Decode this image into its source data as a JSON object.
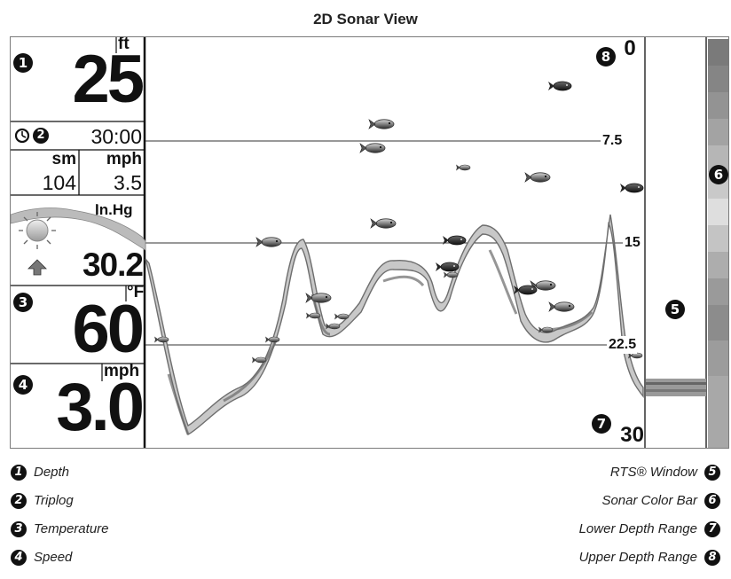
{
  "title": "2D Sonar View",
  "callouts": {
    "c1": "1",
    "c2": "2",
    "c3": "3",
    "c4": "4",
    "c5": "5",
    "c6": "6",
    "c7": "7",
    "c8": "8"
  },
  "readouts": {
    "depth_unit": "ft",
    "depth_value": "25",
    "timer_value": "30:00",
    "distance_unit": "sm",
    "speed_unit_small": "mph",
    "distance_value": "104",
    "speed_small_value": "3.5",
    "pressure_unit": "In.Hg",
    "pressure_value": "30.2",
    "temp_unit": "°F",
    "temp_value": "60",
    "speed_unit": "mph",
    "speed_value": "3.0"
  },
  "depth_scale": {
    "upper": "0",
    "lower": "30",
    "lines": [
      "7.5",
      "15",
      "22.5"
    ]
  },
  "legend": {
    "left": [
      {
        "num": "1",
        "label": "Depth"
      },
      {
        "num": "2",
        "label": "Triplog"
      },
      {
        "num": "3",
        "label": "Temperature"
      },
      {
        "num": "4",
        "label": "Speed"
      }
    ],
    "right": [
      {
        "num": "5",
        "label": "RTS® Window"
      },
      {
        "num": "6",
        "label": "Sonar Color Bar"
      },
      {
        "num": "7",
        "label": "Lower Depth Range"
      },
      {
        "num": "8",
        "label": "Upper Depth Range"
      }
    ]
  },
  "colors": {
    "frame": "#7a7a7a",
    "bottom_dark": "#777777",
    "bottom_light": "#cccccc",
    "fish_dark": "#222222"
  }
}
